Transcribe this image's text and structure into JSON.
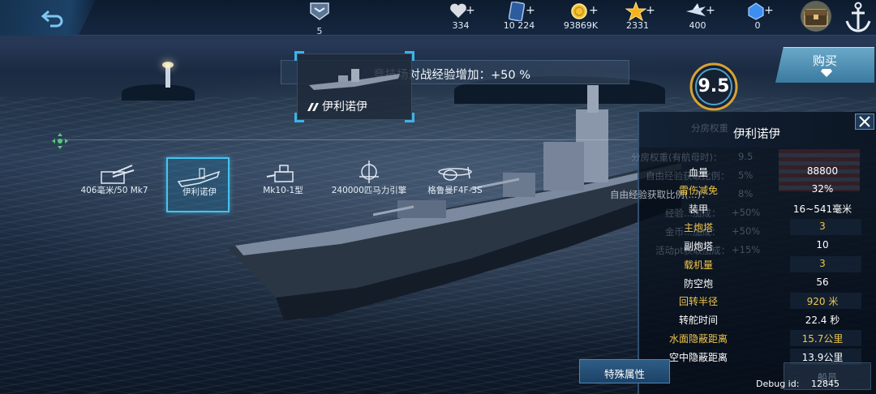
{
  "topbar": {
    "rank_level": "5",
    "resources": [
      {
        "icon": "heart-icon",
        "value": "334",
        "color": "#d9dde3"
      },
      {
        "icon": "card-icon",
        "value": "10 224",
        "color": "#4c7fc4"
      },
      {
        "icon": "gold-coin-icon",
        "value": "93869K",
        "color": "#f2c233"
      },
      {
        "icon": "star-icon",
        "value": "2331",
        "color": "#f5b21c"
      },
      {
        "icon": "plane-icon",
        "value": "400",
        "color": "#cfe0f0"
      },
      {
        "icon": "blue-gem-icon",
        "value": "0",
        "color": "#3e8ef0"
      }
    ],
    "plus_symbol": "+"
  },
  "banner": {
    "exp_bonus_text": "竞技场对战经验增加：+50 %"
  },
  "ship_card": {
    "name": "伊利诺伊"
  },
  "score": {
    "value": "9.5"
  },
  "buy_button": {
    "label": "购买"
  },
  "weapons": [
    {
      "label": "406毫米/50 Mk7",
      "icon": "main-gun-icon",
      "selected": false
    },
    {
      "label": "伊利诺伊",
      "icon": "ship-hull-icon",
      "selected": true
    },
    {
      "label": "Mk10-1型",
      "icon": "secondary-gun-icon",
      "selected": false
    },
    {
      "label": "240000匹马力引擎",
      "icon": "engine-icon",
      "selected": false
    },
    {
      "label": "格鲁曼F4F-3S",
      "icon": "aircraft-icon",
      "selected": false
    }
  ],
  "panel": {
    "title": "伊利诺伊",
    "ghost_header": "分房权重",
    "ghost_rows": [
      {
        "label": "分房权重(有航母时)：",
        "value": "9.5"
      },
      {
        "label": "自由经验获取比例：",
        "value": "5%"
      },
      {
        "label": "自由经验获取比例(...)：",
        "value": "8%"
      },
      {
        "label": "经验...加成：",
        "value": "+50%"
      },
      {
        "label": "金币...加成：",
        "value": "+50%"
      },
      {
        "label": "活动pt获取加成：",
        "value": "+15%"
      }
    ],
    "stats": [
      {
        "label": "血量",
        "value": "88800",
        "gold_label": false,
        "gold_value": false
      },
      {
        "label": "雷伤减免",
        "value": "32%",
        "gold_label": true,
        "gold_value": false
      },
      {
        "label": "装甲",
        "value": "16~541毫米",
        "gold_label": false,
        "gold_value": false
      },
      {
        "label": "主炮塔",
        "value": "3",
        "gold_label": true,
        "gold_value": true
      },
      {
        "label": "副炮塔",
        "value": "10",
        "gold_label": false,
        "gold_value": false
      },
      {
        "label": "载机量",
        "value": "3",
        "gold_label": true,
        "gold_value": true
      },
      {
        "label": "防空炮",
        "value": "56",
        "gold_label": false,
        "gold_value": false
      },
      {
        "label": "回转半径",
        "value": "920 米",
        "gold_label": true,
        "gold_value": true
      },
      {
        "label": "转舵时间",
        "value": "22.4 秒",
        "gold_label": false,
        "gold_value": false
      },
      {
        "label": "水面隐蔽距离",
        "value": "15.7公里",
        "gold_label": true,
        "gold_value": true
      },
      {
        "label": "空中隐蔽距离",
        "value": "13.9公里",
        "gold_label": false,
        "gold_value": false
      }
    ]
  },
  "buttons": {
    "special_attributes": "特殊属性",
    "crew": "船员"
  },
  "debug": {
    "label": "Debug id:",
    "id": "12845"
  },
  "colors": {
    "accent_cyan": "#46c3ef",
    "gold_text": "#f0c74a"
  }
}
